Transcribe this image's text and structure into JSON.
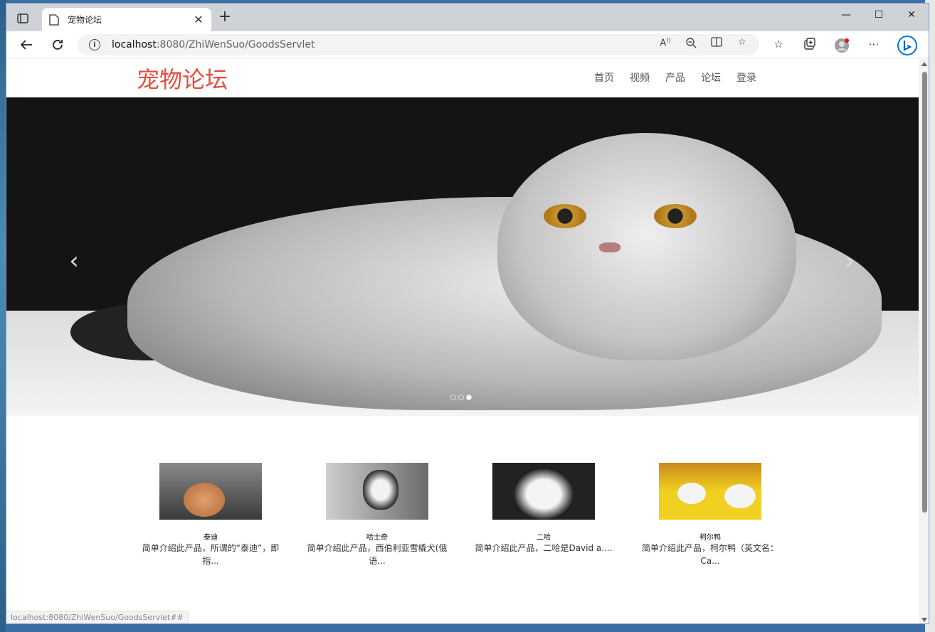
{
  "browser": {
    "tab_title": "宠物论坛",
    "tab_close": "✕",
    "new_tab": "+",
    "url_host": "localhost",
    "url_path": ":8080/ZhiWenSuo/GoodsServlet",
    "info": "i",
    "window_controls": {
      "minimize": "—",
      "maximize": "☐",
      "close": "✕"
    },
    "status_url": "localhost:8080/ZhiWenSuo/GoodsServlet##"
  },
  "site": {
    "logo": "宠物论坛",
    "nav": [
      "首页",
      "视频",
      "产品",
      "论坛",
      "登录"
    ]
  },
  "carousel": {
    "prev": "‹",
    "next": "›",
    "slide_count": 3,
    "active_slide": 3
  },
  "products": [
    {
      "name": "泰迪",
      "desc": "简单介绍此产品，所谓的“泰迪”，即指..."
    },
    {
      "name": "哈士奇",
      "desc": "简单介绍此产品，西伯利亚雪橇犬(俄语..."
    },
    {
      "name": "二哈",
      "desc": "简单介绍此产品，二哈是David a...."
    },
    {
      "name": "柯尔鸭",
      "desc": "简单介绍此产品，柯尔鸭（英文名：Ca..."
    }
  ],
  "colors": {
    "logo": "#e74c3c",
    "accent": "#0078d4"
  }
}
